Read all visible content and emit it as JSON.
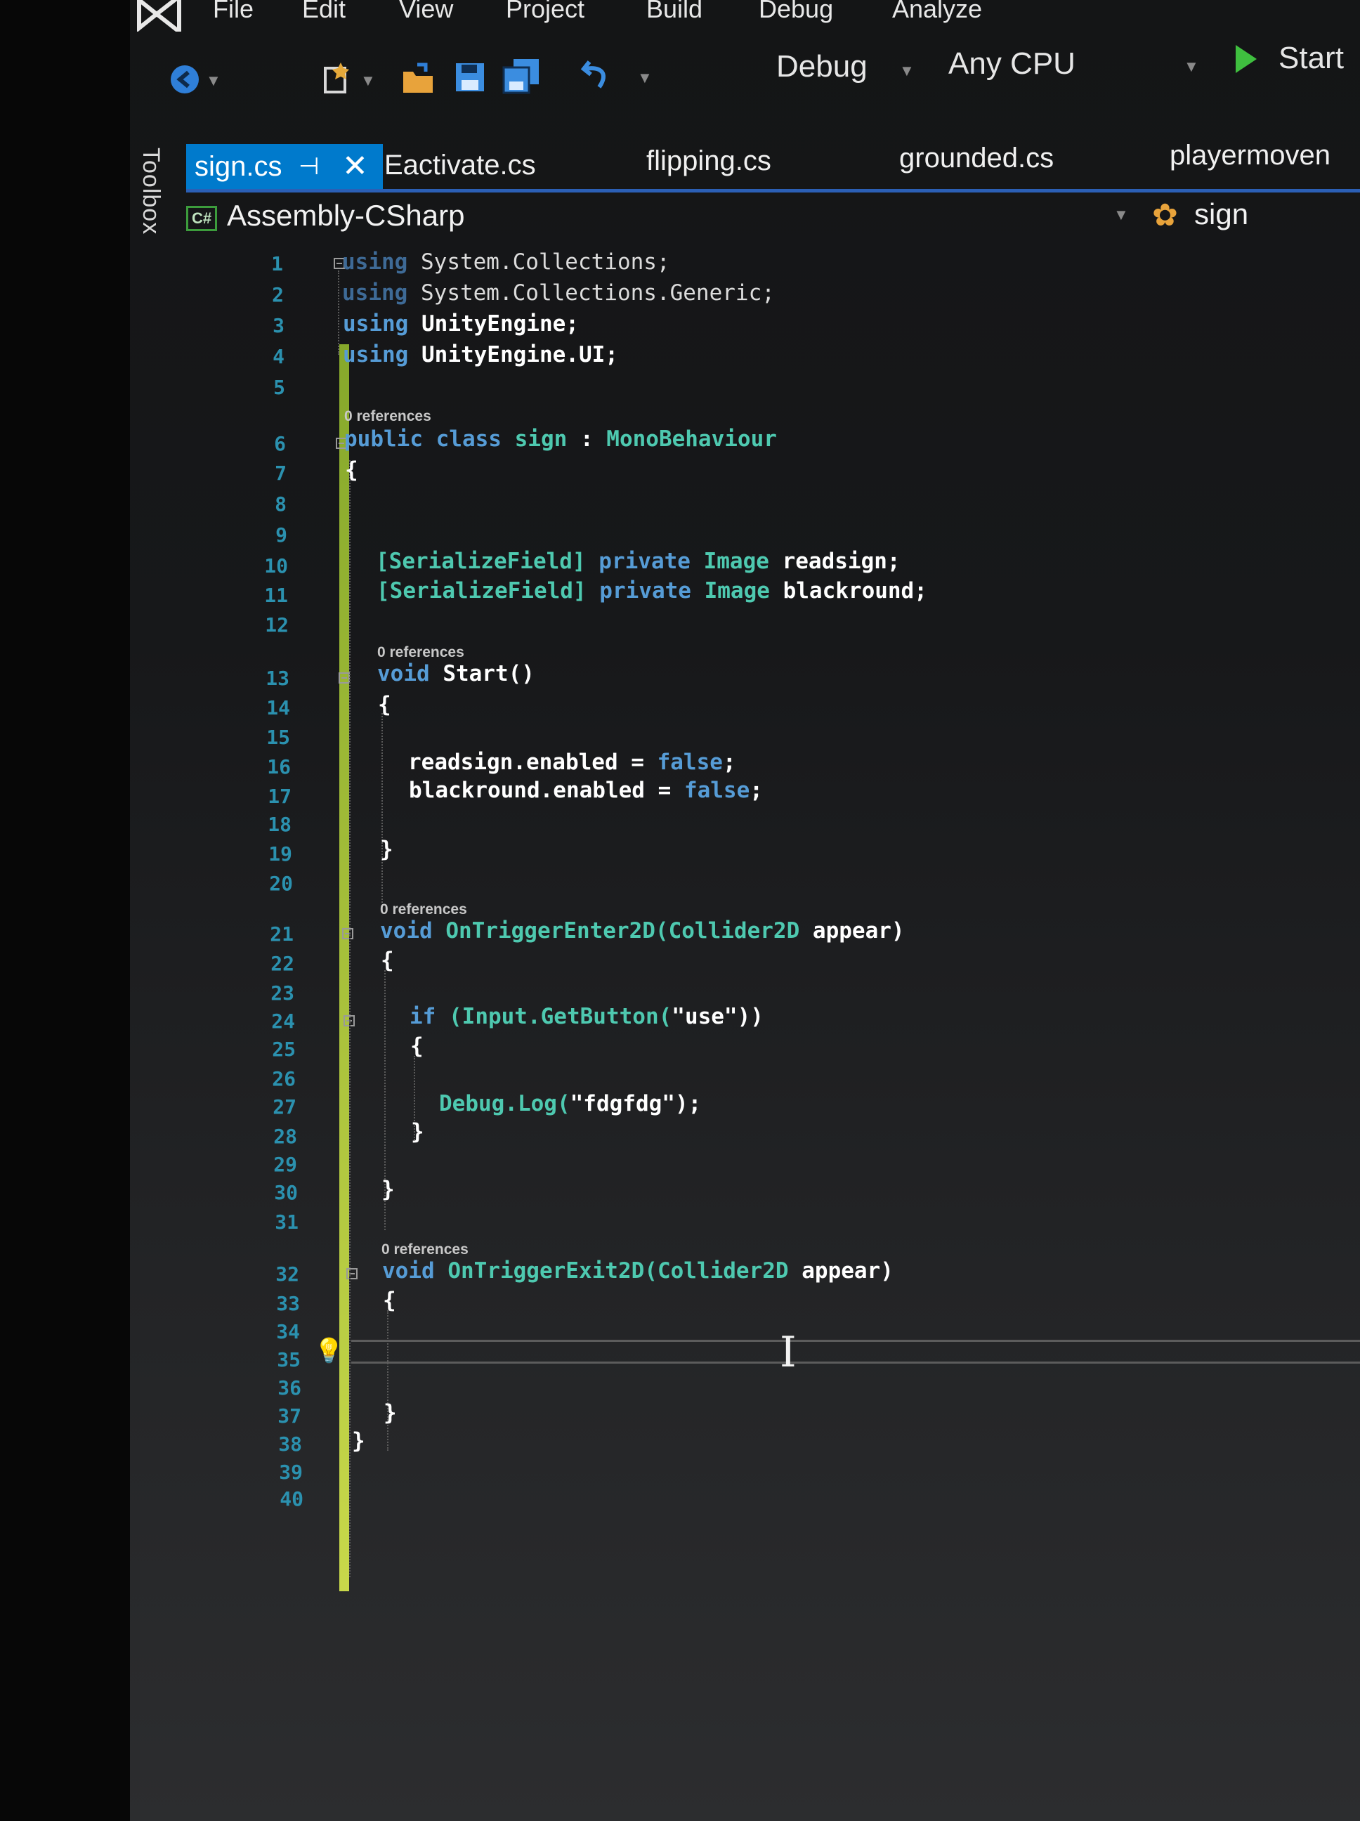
{
  "menu": {
    "items": [
      "File",
      "Edit",
      "View",
      "Project",
      "Build",
      "Debug",
      "Analyze"
    ]
  },
  "toolbar": {
    "configuration": "Debug",
    "platform": "Any CPU",
    "start_label": "Start"
  },
  "toolbox_label": "Toolbox",
  "tabs": [
    {
      "label": "sign.cs",
      "active": true
    },
    {
      "label": "Eactivate.cs"
    },
    {
      "label": "flipping.cs"
    },
    {
      "label": "grounded.cs"
    },
    {
      "label": "playermoven"
    }
  ],
  "navbar": {
    "project": "Assembly-CSharp",
    "project_icon_text": "C#",
    "class": "sign"
  },
  "line_numbers": [
    "1",
    "2",
    "3",
    "4",
    "5",
    "6",
    "7",
    "8",
    "9",
    "10",
    "11",
    "12",
    "13",
    "14",
    "15",
    "16",
    "17",
    "18",
    "19",
    "20",
    "21",
    "22",
    "23",
    "24",
    "25",
    "26",
    "27",
    "28",
    "29",
    "30",
    "31",
    "32",
    "33",
    "34",
    "35",
    "36",
    "37",
    "38",
    "39",
    "40"
  ],
  "code": {
    "l1_kw": "using",
    "l1_rest": " System.Collections;",
    "l2_kw": "using",
    "l2_rest": " System.Collections.Generic;",
    "l3_kw": "using",
    "l3_rest": " UnityEngine;",
    "l4_kw": "using",
    "l4_rest": " UnityEngine.UI;",
    "refs": "0 references",
    "l6_kw": "public class",
    "l6_name": " sign ",
    "l6_colon": ":",
    "l6_base": " MonoBehaviour",
    "l7": "{",
    "l10_attr": "[SerializeField]",
    "l10_kw": " private",
    "l10_type": " Image",
    "l10_name": " readsign;",
    "l11_attr": "[SerializeField]",
    "l11_kw": " private",
    "l11_type": " Image",
    "l11_name": " blackround;",
    "l13_kw": "void",
    "l13_rest": " Start()",
    "l14": "{",
    "l16_a": "readsign.enabled = ",
    "l16_b": "false",
    "l16_c": ";",
    "l17_a": "blackround.enabled = ",
    "l17_b": "false",
    "l17_c": ";",
    "l19": "}",
    "l21_kw": "void",
    "l21_rest": " OnTriggerEnter2D(",
    "l21_type": "Collider2D",
    "l21_end": " appear)",
    "l22": "{",
    "l24_kw": "if",
    "l24_rest": " (Input.GetButton(",
    "l24_str": "\"use\"",
    "l24_end": "))",
    "l25": "{",
    "l27_a": "Debug.Log(",
    "l27_str": "\"fdgfdg\"",
    "l27_end": ");",
    "l28": "}",
    "l30": "}",
    "l32_kw": "void",
    "l32_rest": " OnTriggerExit2D(",
    "l32_type": "Collider2D",
    "l32_end": " appear)",
    "l33": "{",
    "l37": "}",
    "l38": "}"
  },
  "colors": {
    "accent_tab": "#007acc",
    "keyword": "#569cd6",
    "type": "#4ec9b0",
    "line_number": "#2b91af",
    "change_bar": "#a8c23a"
  }
}
